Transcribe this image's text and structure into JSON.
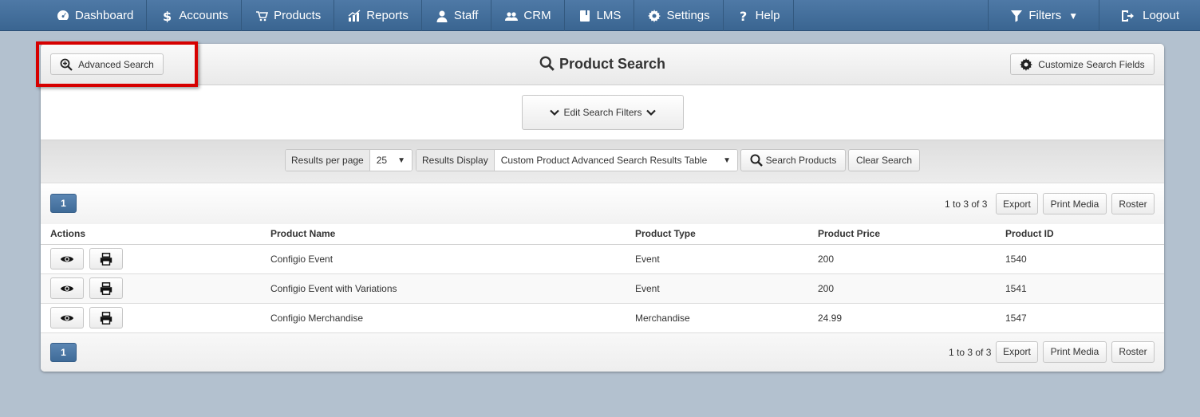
{
  "nav": {
    "items": [
      {
        "label": "Dashboard",
        "icon": "dashboard-icon"
      },
      {
        "label": "Accounts",
        "icon": "dollar-icon"
      },
      {
        "label": "Products",
        "icon": "cart-icon"
      },
      {
        "label": "Reports",
        "icon": "chart-icon"
      },
      {
        "label": "Staff",
        "icon": "user-icon"
      },
      {
        "label": "CRM",
        "icon": "users-icon"
      },
      {
        "label": "LMS",
        "icon": "book-icon"
      },
      {
        "label": "Settings",
        "icon": "gear-icon"
      },
      {
        "label": "Help",
        "icon": "question-icon"
      }
    ],
    "filters_label": "Filters",
    "logout_label": "Logout"
  },
  "header": {
    "advanced_search_label": "Advanced Search",
    "title": "Product Search",
    "customize_label": "Customize Search Fields"
  },
  "filters": {
    "edit_label": "Edit Search Filters"
  },
  "options": {
    "results_per_page_label": "Results per page",
    "results_per_page_value": "25",
    "results_display_label": "Results Display",
    "results_display_value": "Custom Product Advanced Search Results Table",
    "search_label": "Search Products",
    "clear_label": "Clear Search"
  },
  "pager": {
    "page": "1",
    "count_text": "1 to 3 of 3",
    "export_label": "Export",
    "print_label": "Print Media",
    "roster_label": "Roster"
  },
  "table": {
    "headers": {
      "actions": "Actions",
      "name": "Product Name",
      "type": "Product Type",
      "price": "Product Price",
      "id": "Product ID"
    },
    "rows": [
      {
        "name": "Configio Event",
        "type": "Event",
        "price": "200",
        "id": "1540"
      },
      {
        "name": "Configio Event with Variations",
        "type": "Event",
        "price": "200",
        "id": "1541"
      },
      {
        "name": "Configio Merchandise",
        "type": "Merchandise",
        "price": "24.99",
        "id": "1547"
      }
    ]
  },
  "colors": {
    "nav_bg": "#3f6b98",
    "page_bg": "#b3c1cf",
    "highlight": "#d60000"
  }
}
